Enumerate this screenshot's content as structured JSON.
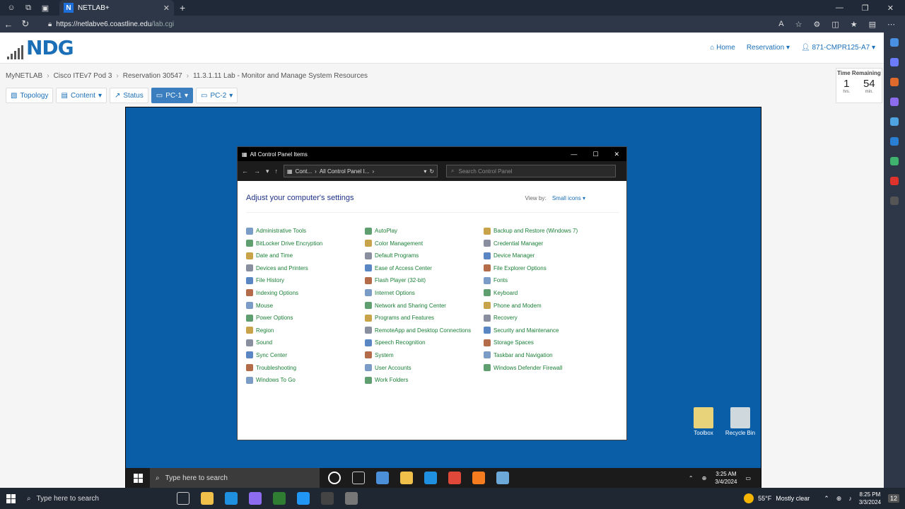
{
  "browser": {
    "tab_title": "NETLAB+",
    "tab_favicon": "N",
    "url_host": "https://netlabve6.coastline.edu",
    "url_path": "/lab.cgi"
  },
  "header": {
    "logo": "NDG",
    "nav": {
      "home": "Home",
      "reservation": "Reservation",
      "user": "871-CMPR125-A7"
    }
  },
  "breadcrumb": [
    "MyNETLAB",
    "Cisco ITEv7 Pod 3",
    "Reservation 30547",
    "11.3.1.11 Lab - Monitor and Manage System Resources"
  ],
  "toolbar": {
    "topology": "Topology",
    "content": "Content",
    "status": "Status",
    "pc1": "PC-1",
    "pc2": "PC-2"
  },
  "time_remaining": {
    "label": "Time Remaining",
    "hours": "1",
    "hours_unit": "hrs.",
    "minutes": "54",
    "minutes_unit": "min."
  },
  "control_panel": {
    "title": "All Control Panel Items",
    "path_part1": "Cont...",
    "path_part2": "All Control Panel I...",
    "search_placeholder": "Search Control Panel",
    "heading": "Adjust your computer's settings",
    "view_by_label": "View by:",
    "view_by_value": "Small icons",
    "items": [
      [
        "Administrative Tools",
        "AutoPlay",
        "Backup and Restore (Windows 7)"
      ],
      [
        "BitLocker Drive Encryption",
        "Color Management",
        "Credential Manager"
      ],
      [
        "Date and Time",
        "Default Programs",
        "Device Manager"
      ],
      [
        "Devices and Printers",
        "Ease of Access Center",
        "File Explorer Options"
      ],
      [
        "File History",
        "Flash Player (32-bit)",
        "Fonts"
      ],
      [
        "Indexing Options",
        "Internet Options",
        "Keyboard"
      ],
      [
        "Mouse",
        "Network and Sharing Center",
        "Phone and Modem"
      ],
      [
        "Power Options",
        "Programs and Features",
        "Recovery"
      ],
      [
        "Region",
        "RemoteApp and Desktop Connections",
        "Security and Maintenance"
      ],
      [
        "Sound",
        "Speech Recognition",
        "Storage Spaces"
      ],
      [
        "Sync Center",
        "System",
        "Taskbar and Navigation"
      ],
      [
        "Troubleshooting",
        "User Accounts",
        "Windows Defender Firewall"
      ],
      [
        "Windows To Go",
        "Work Folders",
        ""
      ]
    ]
  },
  "desktop_icons": {
    "toolbox": "Toolbox",
    "recycle": "Recycle Bin"
  },
  "vm_taskbar": {
    "search_placeholder": "Type here to search",
    "time": "3:25 AM",
    "date": "3/4/2024"
  },
  "host_taskbar": {
    "search_placeholder": "Type here to search",
    "weather_temp": "55°F",
    "weather_desc": "Mostly clear",
    "time": "8:25 PM",
    "date": "3/3/2024",
    "notif_count": "12"
  }
}
